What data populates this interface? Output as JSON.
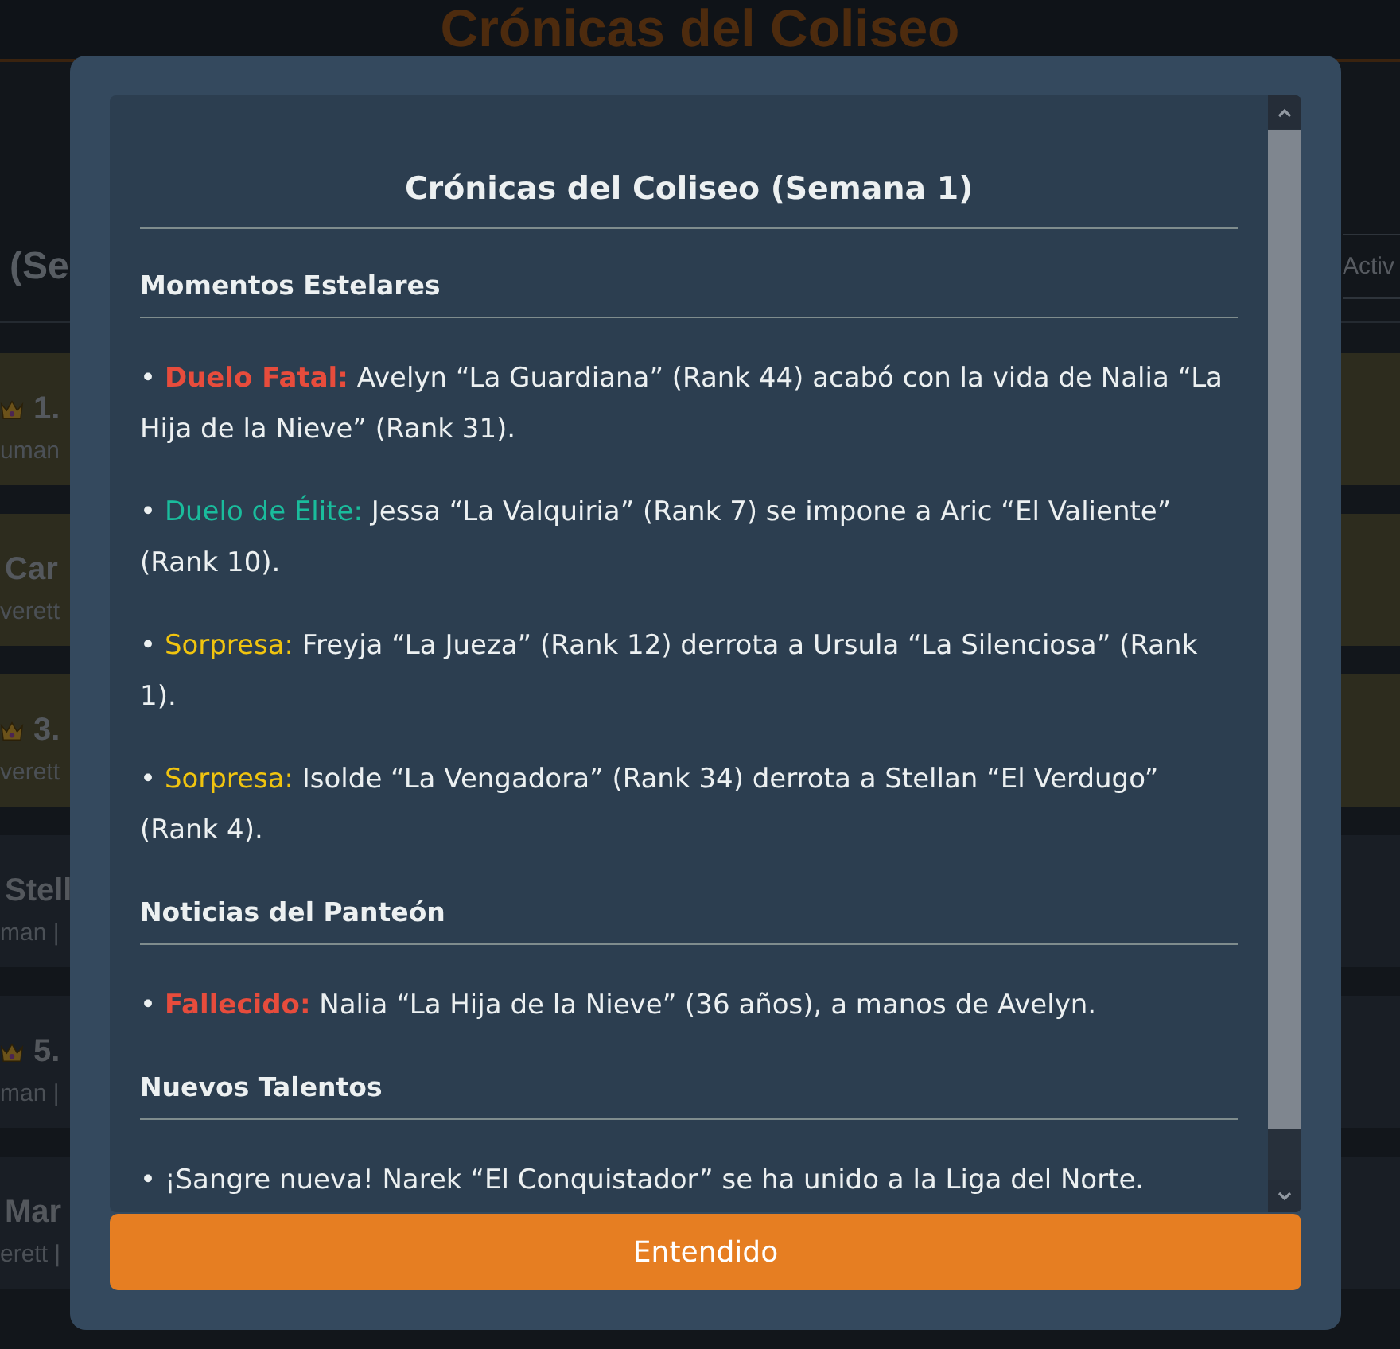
{
  "page": {
    "title": "Crónicas del Coliseo",
    "section_heading": "(Se",
    "filter_button": "Activ",
    "cards": [
      {
        "highlighted": true,
        "crowned": true,
        "title": "1.",
        "subtitle": "uman"
      },
      {
        "highlighted": true,
        "crowned": false,
        "title": "Car",
        "subtitle": "verett"
      },
      {
        "highlighted": true,
        "crowned": true,
        "title": "3.",
        "subtitle": "verett"
      },
      {
        "highlighted": false,
        "crowned": false,
        "title": "Stell",
        "subtitle": "man |"
      },
      {
        "highlighted": false,
        "crowned": true,
        "title": "5.",
        "subtitle": "man |"
      },
      {
        "highlighted": false,
        "crowned": false,
        "title": "Mar",
        "subtitle": "erett |"
      }
    ]
  },
  "dialog": {
    "title": "Crónicas del Coliseo (Semana 1)",
    "sections": [
      {
        "heading": "Momentos Estelares",
        "items": [
          {
            "kind": "alert",
            "bullet": "•",
            "tag": "Duelo Fatal:",
            "color": "#e74c3c",
            "text": "Avelyn “La Guardiana” (Rank 44) acabó con la vida de Nalia “La Hija de la Nieve” (Rank 31)."
          },
          {
            "kind": "highlight",
            "bullet": "•",
            "tag": "Duelo de Élite:",
            "color": "#1abc9c",
            "text": "Jessa “La Valquiria” (Rank 7) se impone a Aric “El Valiente” (Rank 10)."
          },
          {
            "kind": "highlight",
            "bullet": "•",
            "tag": "Sorpresa:",
            "color": "#f1c40f",
            "text": "Freyja “La Jueza” (Rank 12) derrota a Ursula “La Silenciosa” (Rank 1)."
          },
          {
            "kind": "highlight",
            "bullet": "•",
            "tag": "Sorpresa:",
            "color": "#f1c40f",
            "text": "Isolde “La Vengadora” (Rank 34) derrota a Stellan “El Verdugo” (Rank 4)."
          }
        ]
      },
      {
        "heading": "Noticias del Panteón",
        "items": [
          {
            "kind": "alert",
            "bullet": "•",
            "tag": "Fallecido:",
            "color": "#e74c3c",
            "text": "Nalia “La Hija de la Nieve” (36 años), a manos de Avelyn."
          }
        ]
      },
      {
        "heading": "Nuevos Talentos",
        "items": [
          {
            "kind": "plain",
            "bullet": "•",
            "text": "¡Sangre nueva! Narek “El Conquistador” se ha unido a la Liga del Norte."
          }
        ]
      }
    ],
    "button": "Entendido"
  }
}
